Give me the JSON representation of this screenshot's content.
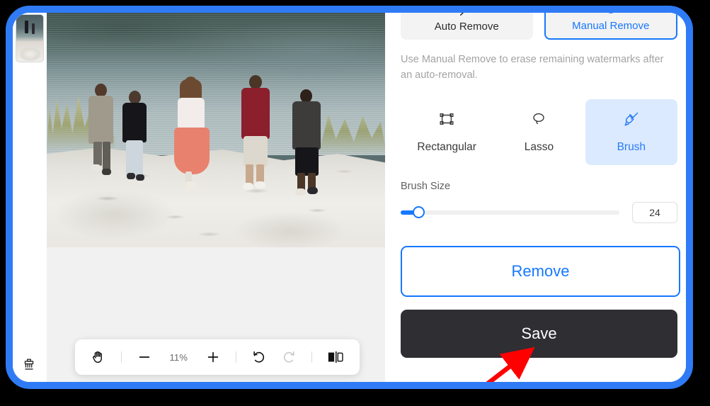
{
  "app": {
    "accent_color": "#1677ff",
    "frame_color": "#2f7bf6",
    "panel_bg": "#ffffff",
    "canvas_bg": "#f1f1f1",
    "save_bg": "#2e2e33",
    "tool_active_bg": "#dbeafe",
    "annotation_arrow_color": "#ff0000"
  },
  "left_rail": {
    "thumbnail_name": "image-thumbnail",
    "broom_icon": "broom-icon"
  },
  "canvas": {
    "photo_alt": "Five people walking on white sand beach toward a lake",
    "toolbar": {
      "pan_icon": "hand-pan-icon",
      "zoom_out_label": "−",
      "zoom_level": "11%",
      "zoom_in_label": "+",
      "undo_icon": "undo-icon",
      "redo_icon": "redo-icon",
      "redo_disabled": true,
      "compare_icon": "before-after-compare-icon"
    }
  },
  "right_panel": {
    "tabs": [
      {
        "label": "Auto Remove",
        "icon": "auto-magic-wand-icon",
        "active": false
      },
      {
        "label": "Manual Remove",
        "icon": "circle-manual-icon",
        "active": true
      }
    ],
    "hint": "Use Manual Remove to erase remaining watermarks after an auto-removal.",
    "tools": [
      {
        "label": "Rectangular",
        "icon": "rectangular-select-icon",
        "active": false
      },
      {
        "label": "Lasso",
        "icon": "lasso-select-icon",
        "active": false
      },
      {
        "label": "Brush",
        "icon": "brush-icon",
        "active": true
      }
    ],
    "brush_size": {
      "label": "Brush Size",
      "value": "24",
      "min": 1,
      "max": 300,
      "fill_percent": 8
    },
    "remove_label": "Remove",
    "save_label": "Save"
  }
}
